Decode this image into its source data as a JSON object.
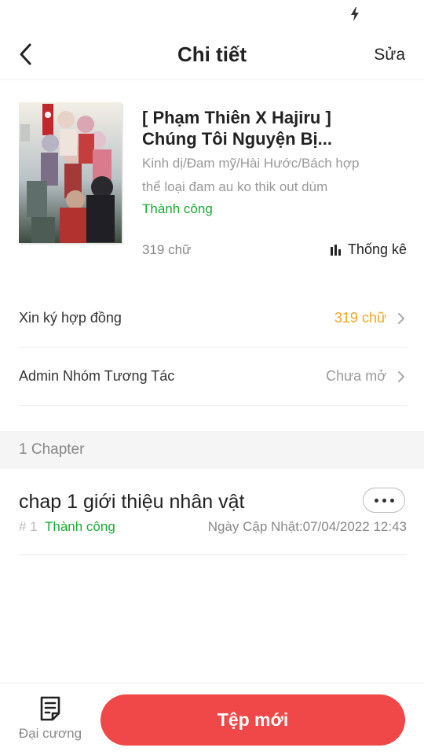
{
  "status_bar": {
    "charging_icon": "lightning-bolt-icon"
  },
  "header": {
    "back_icon": "chevron-left-icon",
    "title": "Chi tiết",
    "edit_label": "Sửa"
  },
  "book": {
    "cover_image": "book-cover-illustration",
    "title_line1": "[ Phạm Thiên X Hajiru ]",
    "title_line2": "Chúng Tôi Nguyện Bị...",
    "genres": "Kinh dị/Đam mỹ/Hài Hước/Bách hợp",
    "description": "thể loại đam au ko thik out dùm",
    "status": "Thành công",
    "word_count": "319 chữ",
    "stats_label": "Thống kê",
    "stats_icon": "bar-chart-icon",
    "colors": {
      "status": "#1aaa36",
      "muted": "#999999"
    }
  },
  "rows": [
    {
      "label": "Xin ký hợp đồng",
      "value": "319 chữ",
      "value_color": "#f5a623"
    },
    {
      "label": "Admin Nhóm Tương Tác",
      "value": "Chưa mở",
      "value_color": "#999999"
    }
  ],
  "chapters_section": {
    "heading": "1 Chapter",
    "items": [
      {
        "title": "chap 1 giới thiệu nhân vật",
        "number": "# 1",
        "status": "Thành công",
        "updated": "Ngày Cập Nhật:07/04/2022 12:43",
        "menu_icon": "more-horizontal-icon"
      }
    ]
  },
  "bottom_bar": {
    "outline_label": "Đại cương",
    "outline_icon": "document-list-icon",
    "new_button_label": "Tệp mới",
    "accent_color": "#f04848"
  }
}
